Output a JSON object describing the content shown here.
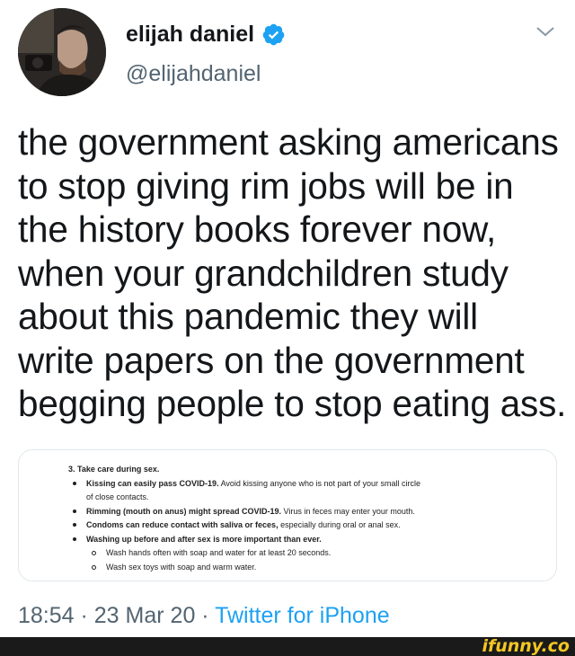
{
  "user": {
    "display_name": "elijah daniel",
    "handle": "@elijahdaniel",
    "verified": true,
    "verified_color": "#1da1f2"
  },
  "tweet": {
    "lines": [
      "the government asking americans",
      "to stop giving rim jobs will be in",
      "the history books forever now,",
      "when your grandchildren study",
      "about this pandemic they will",
      "write papers on the government",
      "begging people to stop eating ass."
    ]
  },
  "attachment": {
    "heading": "3. Take care during sex.",
    "items": [
      {
        "bold": "Kissing can easily pass COVID-19.",
        "rest": " Avoid kissing anyone who is not part of your small circle",
        "cont": "of close contacts."
      },
      {
        "bold": "Rimming (mouth on anus) might spread COVID-19.",
        "rest": " Virus in feces may enter your mouth."
      },
      {
        "bold": "Condoms can reduce contact with saliva or feces,",
        "rest": " especially during oral or anal sex."
      },
      {
        "bold": "Washing up before and after sex is more important than ever.",
        "rest": ""
      }
    ],
    "subitems": [
      "Wash hands often with soap and water for at least 20 seconds.",
      "Wash sex toys with soap and warm water."
    ]
  },
  "meta": {
    "time": "18:54",
    "sep1": " · ",
    "date": "23 Mar 20",
    "sep2": " · ",
    "source": "Twitter for iPhone"
  },
  "watermark": {
    "text": "ifunny.co",
    "color": "#f3c623"
  },
  "icons": [
    "verified-badge-icon",
    "chevron-down-icon"
  ]
}
